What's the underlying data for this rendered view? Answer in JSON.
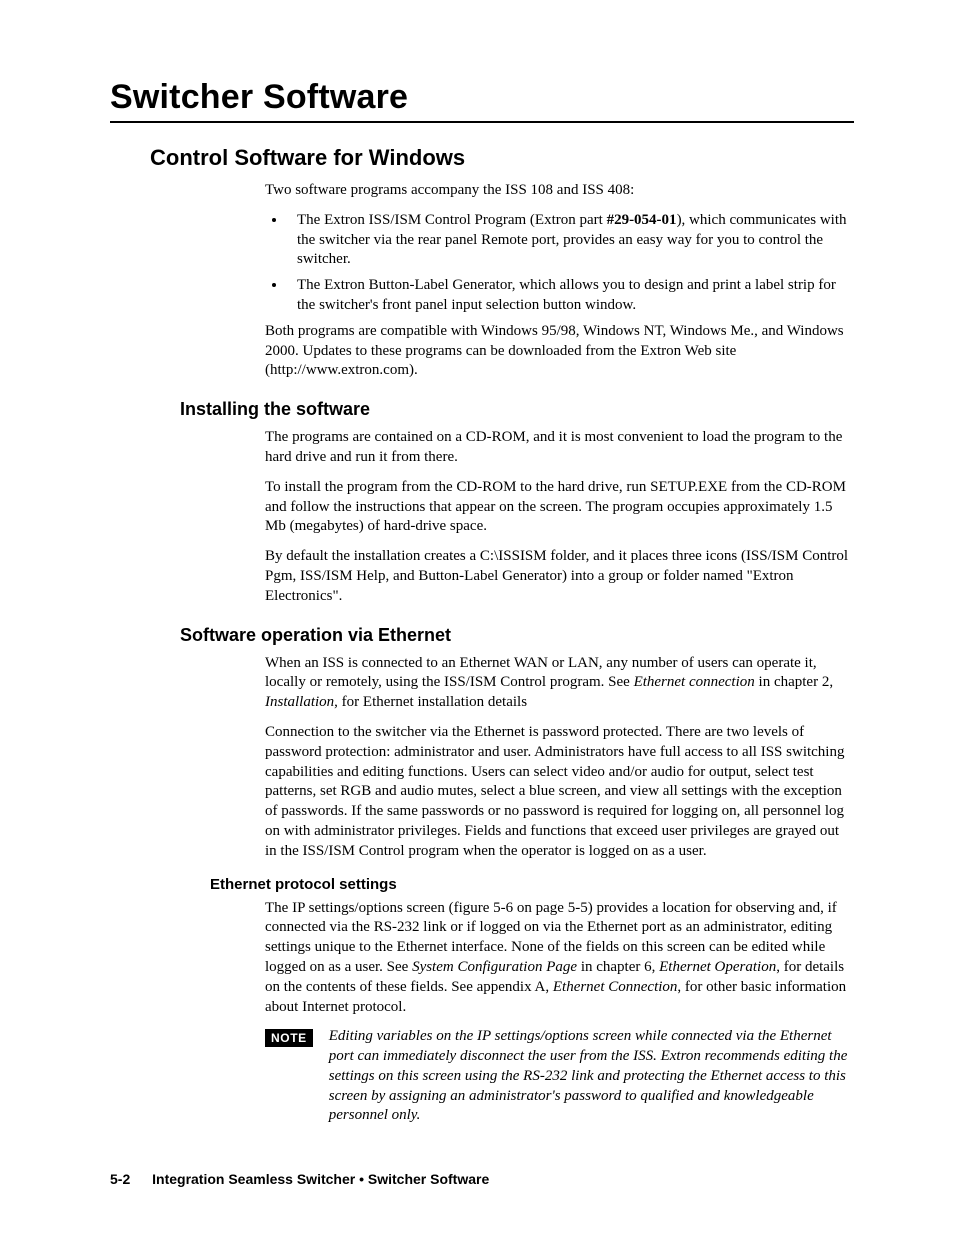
{
  "chapter_title": "Switcher Software",
  "section": {
    "title": "Control Software for Windows",
    "intro": "Two software programs accompany the ISS 108 and ISS 408:",
    "bullets": [
      {
        "pre": "The Extron ISS/ISM Control Program (Extron part ",
        "bold": "#29-054-01",
        "post": "), which communicates with the switcher via the rear panel Remote port, provides an easy way for you to control the switcher."
      },
      {
        "text": "The Extron Button-Label Generator, which allows you to design and print a label strip for the switcher's front panel input selection button window."
      }
    ],
    "after_bullets": "Both programs are compatible with Windows 95/98, Windows NT, Windows Me., and Windows 2000.  Updates to these programs can be downloaded from the Extron Web site (http://www.extron.com).",
    "sub1": {
      "title": "Installing the software",
      "p1": "The programs are contained on a CD-ROM, and it is most convenient to load the program to the hard drive and run it from there.",
      "p2": "To install the program from the CD-ROM to the hard drive, run SETUP.EXE from the CD-ROM and follow the instructions that appear on the screen.  The program occupies approximately 1.5 Mb (megabytes) of hard-drive space.",
      "p3": "By default the installation creates a C:\\ISSISM folder, and it places three icons (ISS/ISM Control Pgm, ISS/ISM Help, and Button-Label Generator) into a group or folder named \"Extron Electronics\"."
    },
    "sub2": {
      "title": "Software operation via Ethernet",
      "p1_a": "When an ISS is connected to an Ethernet WAN or LAN, any number of users can operate it, locally or remotely, using the ISS/ISM Control program.  See ",
      "p1_i1": "Ethernet connection",
      "p1_b": " in chapter 2, ",
      "p1_i2": "Installation",
      "p1_c": ", for Ethernet installation details",
      "p2": "Connection to the switcher via the Ethernet is password protected.  There are two levels of password protection: administrator and user.  Administrators have full access to all ISS switching capabilities and editing functions.  Users can select video and/or audio for output, select test patterns, set RGB and audio mutes, select a blue screen, and view all settings with the exception of passwords.  If the same passwords or no password is required for logging on, all personnel log on with administrator privileges.  Fields and functions that exceed user privileges are grayed out in the ISS/ISM Control program when the operator is logged on as a user.",
      "subsub": {
        "title": "Ethernet protocol settings",
        "p1_a": "The IP settings/options screen (figure 5-6 on page 5-5) provides a location for observing and, if connected via the RS-232 link or if logged on via the Ethernet port as an administrator, editing settings unique to the Ethernet interface.  None of the fields on this screen can be edited while logged on as a user.  See ",
        "p1_i1": "System Configuration Page",
        "p1_b": " in chapter 6, ",
        "p1_i2": "Ethernet Operation",
        "p1_c": ", for details on the contents of these fields.  See appendix A, ",
        "p1_i3": "Ethernet Connection",
        "p1_d": ", for other basic information about Internet protocol.",
        "note_label": "NOTE",
        "note_text": "Editing variables on the IP settings/options screen while connected via the Ethernet port can immediately disconnect the user from the ISS.  Extron recommends editing the settings on this screen using the RS-232 link and protecting the Ethernet access to this screen by assigning an administrator's password to qualified and knowledgeable personnel only."
      }
    }
  },
  "footer": {
    "page_number": "5-2",
    "text": "Integration Seamless Switcher • Switcher Software"
  }
}
